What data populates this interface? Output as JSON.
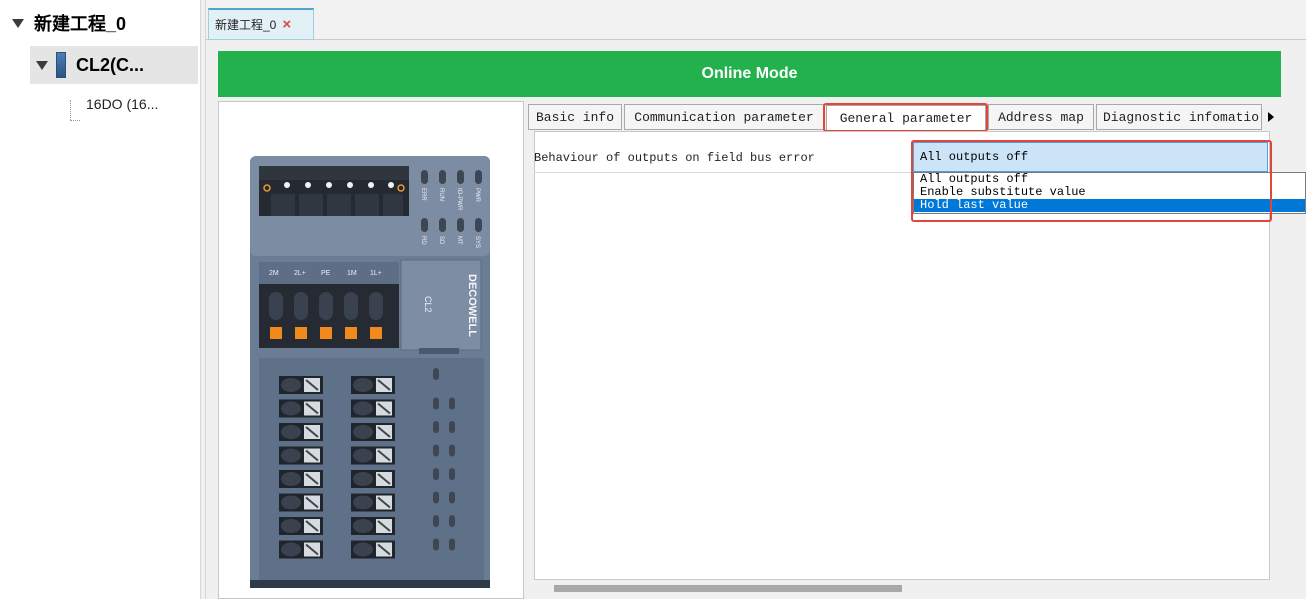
{
  "tree": {
    "project": "新建工程_0",
    "module": "CL2(C...",
    "child": "16DO (16..."
  },
  "doc_tab": {
    "title": "新建工程_0",
    "close": "×"
  },
  "mode_banner": "Online Mode",
  "tabs": [
    {
      "label": "Basic info"
    },
    {
      "label": "Communication parameter"
    },
    {
      "label": "General parameter",
      "active": true
    },
    {
      "label": "Address map"
    },
    {
      "label": "Diagnostic infomatio"
    }
  ],
  "parameter": {
    "label": "Behaviour of outputs on field bus error",
    "current_value": "All outputs off",
    "options": [
      "All outputs off",
      "Enable substitute value",
      "Hold last value"
    ],
    "highlighted_option": "Hold last value"
  },
  "device": {
    "brand": "DECOWELL",
    "model": "CL2",
    "led_top": [
      "ERR",
      "RUN",
      "IO-PWR",
      "PWR"
    ],
    "led_bottom": [
      "RD",
      "SD",
      "MT",
      "SYS"
    ],
    "power_terminals": [
      "2M",
      "2L+",
      "PE",
      "1M",
      "1L+"
    ]
  },
  "colors": {
    "banner": "#22b14c",
    "highlight": "#e0473a",
    "selection": "#0078d7"
  }
}
